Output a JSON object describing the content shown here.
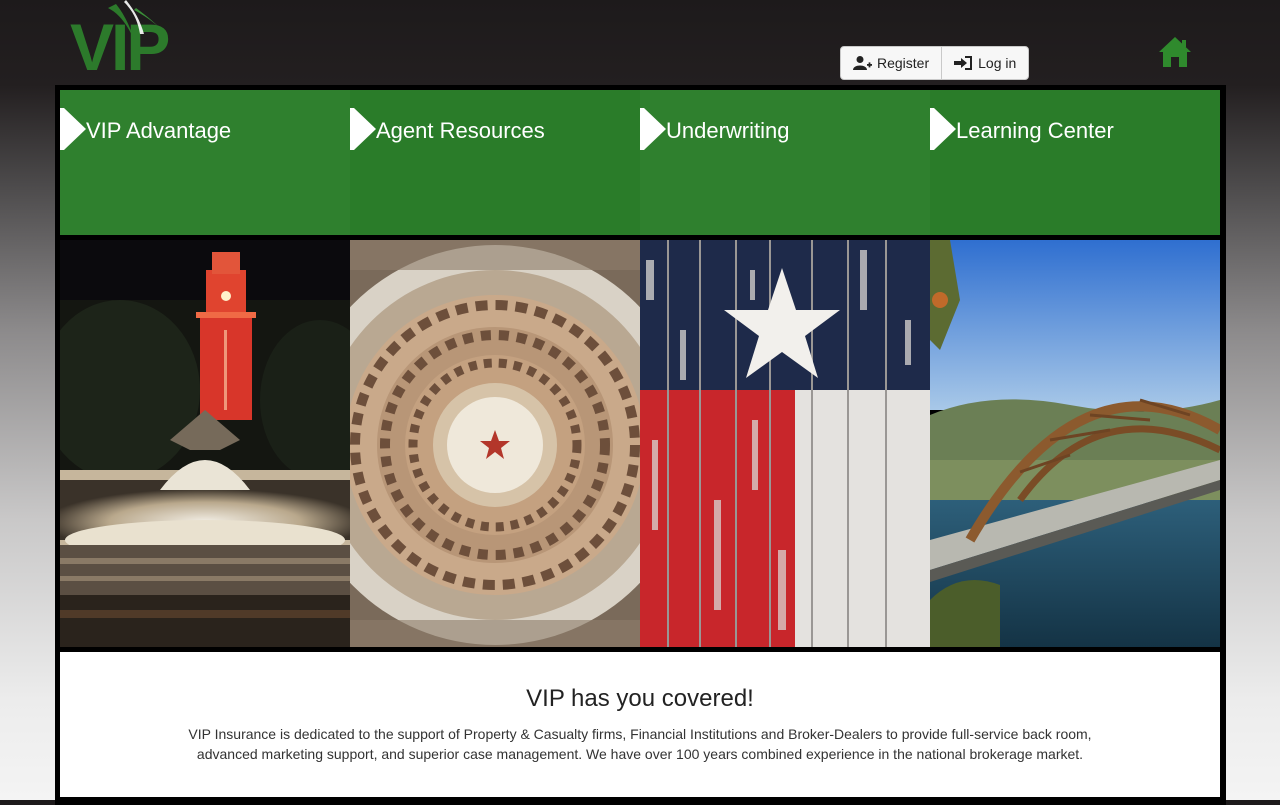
{
  "header": {
    "logo_text": "VIP",
    "register_label": "Register",
    "login_label": "Log in",
    "home_icon": "home-icon"
  },
  "nav": {
    "items": [
      {
        "label": "VIP Advantage"
      },
      {
        "label": "Agent Resources"
      },
      {
        "label": "Underwriting"
      },
      {
        "label": "Learning Center"
      }
    ]
  },
  "photos": {
    "items": [
      "ut-tower-fountain-image",
      "capitol-dome-image",
      "texas-flag-image",
      "pennybacker-bridge-image"
    ]
  },
  "intro": {
    "title": "VIP has you covered!",
    "text": "VIP Insurance is dedicated to the support of Property & Casualty firms, Financial Institutions and Broker-Dealers to provide full-service back room, advanced marketing support, and superior case management. We have over 100 years combined experience in the national brokerage market."
  },
  "colors": {
    "brand_green": "#2d7f2c",
    "header_dark": "#231f20"
  }
}
